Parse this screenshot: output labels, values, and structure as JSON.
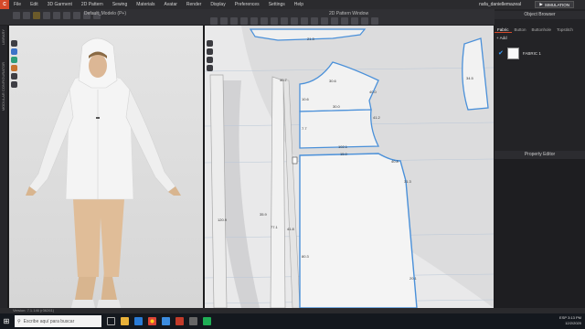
{
  "app": {
    "logo": "C"
  },
  "menu": [
    "File",
    "Edit",
    "3D Garment",
    "2D Pattern",
    "Sewing",
    "Materials",
    "Avatar",
    "Render",
    "Display",
    "Preferences",
    "Settings",
    "Help"
  ],
  "user": {
    "name": "nafa_daniellemazeal",
    "mode_label": "SIMULATION"
  },
  "windows": {
    "view3d_title": "Default_Modelo (P+)",
    "view2d_title": "2D Pattern Window"
  },
  "rail_labels": [
    "LIBRARY",
    "MODULAR CONFIGURATOR"
  ],
  "panel": {
    "object_browser_title": "Object Browser",
    "tabs": [
      "Fabric",
      "Button",
      "Buttonhole",
      "Topstitch"
    ],
    "add_label": "+ Add",
    "fabric_item": "FABRIC 1",
    "property_editor_title": "Property Editor"
  },
  "pattern_labels": [
    "21.3",
    "35.9",
    "40.7",
    "30.6",
    "34.5",
    "40.0",
    "10.6",
    "30.0",
    "41.2",
    "7.7",
    "102.1",
    "15.0",
    "40.8",
    "31.3",
    "20.1",
    "80.3",
    "41.8",
    "120.9",
    "77.1"
  ],
  "status": {
    "version": "Version: 7.1.146 (r36261)"
  },
  "taskbar": {
    "search_placeholder": "Escribe aquí para buscar",
    "time": "3:13 PM",
    "date": "12/2/2020",
    "lang": "ESP"
  }
}
